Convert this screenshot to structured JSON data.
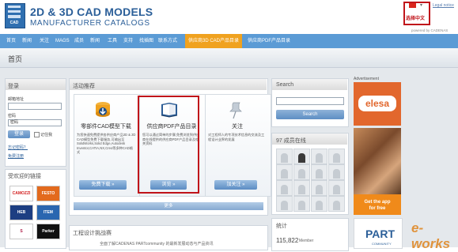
{
  "header": {
    "logo_text": "CAD",
    "title": "2D & 3D CAD MODELS",
    "subtitle": "MANUFACTURER CATALOGS",
    "language_label": "选择中文",
    "legal_link": "Legal notice",
    "powered_by": "powered by CADENAS"
  },
  "nav": {
    "items": [
      "首页",
      "新闻",
      "关注",
      "MAGS",
      "成员",
      "新闻",
      "工具",
      "支持",
      "找插图",
      "联系方式",
      "供应商3D CAD产品目录",
      "供应商PDF产品目录"
    ],
    "active_index": 10,
    "accent": "#f0a21f",
    "bar_color": "#5b9bd5"
  },
  "page": {
    "title": "首页"
  },
  "login": {
    "heading": "登录",
    "email_label": "邮箱地址",
    "password_label": "密码",
    "password_value": "密码",
    "login_button": "登录",
    "remember_label": "记住我",
    "forgot_link": "忘记密码？",
    "register_link": "免费注册"
  },
  "brands": {
    "heading": "受欢迎的链接",
    "items": [
      "CAMOZZI",
      "FESTO",
      "HEB",
      "ITEM",
      "S",
      "Parker"
    ]
  },
  "recommend": {
    "heading": "活动推荐",
    "cards": [
      {
        "icon": "cad-download-icon",
        "title": "零部件CAD模型下载",
        "desc": "为您快速免费提供各供应商产品3D & 2D CAD模型免费下载服务,可输出至SolidWorks,Solid Edge,Autodesk Inventor,CATIA,NX,Creo等多种CAD格式",
        "button": "免费下载 »"
      },
      {
        "icon": "book-icon",
        "title": "供应商PDF产品目录",
        "desc": "您可以通过简单的步骤,免费浏览到供应商在线提供的供应商PDF产品目录及相关资料",
        "button": "浏览 »"
      },
      {
        "icon": "pin-icon",
        "title": "关注",
        "desc": "对工程师人的专项技术信息的交流及工程设计业界的发展",
        "button": "加关注 »"
      }
    ],
    "more_bar": "更多"
  },
  "challenge": {
    "heading": "工程设计挑战赛",
    "footer_text": "全面了解CADENAS PARTcommunity 的最新发展动态与产品资讯"
  },
  "search": {
    "heading": "Search",
    "button": "Search"
  },
  "members": {
    "heading": "97 成员在线"
  },
  "stats": {
    "heading": "统计",
    "count": "115,822",
    "count_label": "Member"
  },
  "ad": {
    "label": "Advertisement",
    "brand": "elesa",
    "cta_line1": "Get the app",
    "cta_line2": "for free",
    "partner": "PART",
    "partner_sub": "COMMUNITY"
  },
  "watermark": "e-works"
}
